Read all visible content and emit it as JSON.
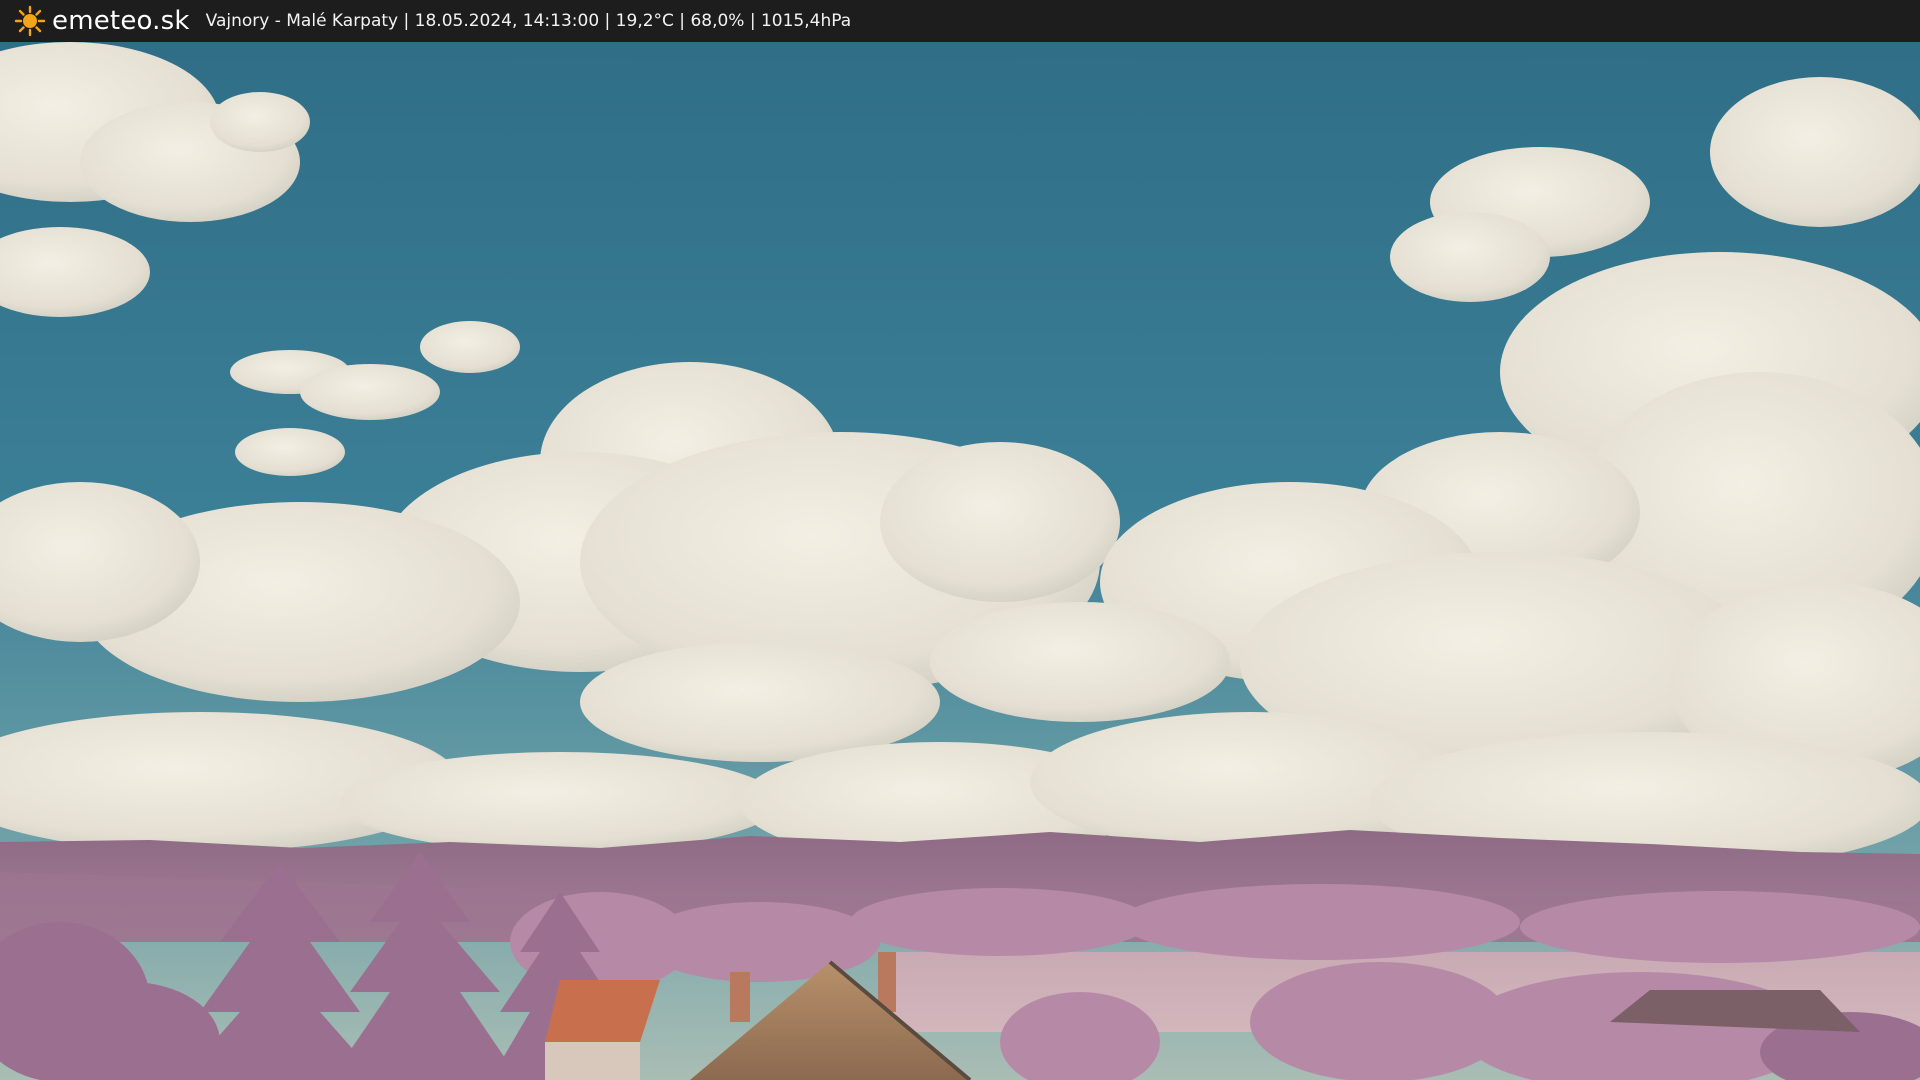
{
  "header": {
    "brand": "emeteo.sk",
    "logo_icon": "sun-icon",
    "status_line": "Vajnory - Malé Karpaty | 18.05.2024, 14:13:00 | 19,2°C | 68,0% | 1015,4hPa"
  },
  "colors": {
    "bar_background": "#1d1d1d",
    "sky": "#3f7f96",
    "cloud": "#ece8dc",
    "foliage": "#b98aa8",
    "roof": "#c8704e",
    "sun": "#f2a516"
  }
}
